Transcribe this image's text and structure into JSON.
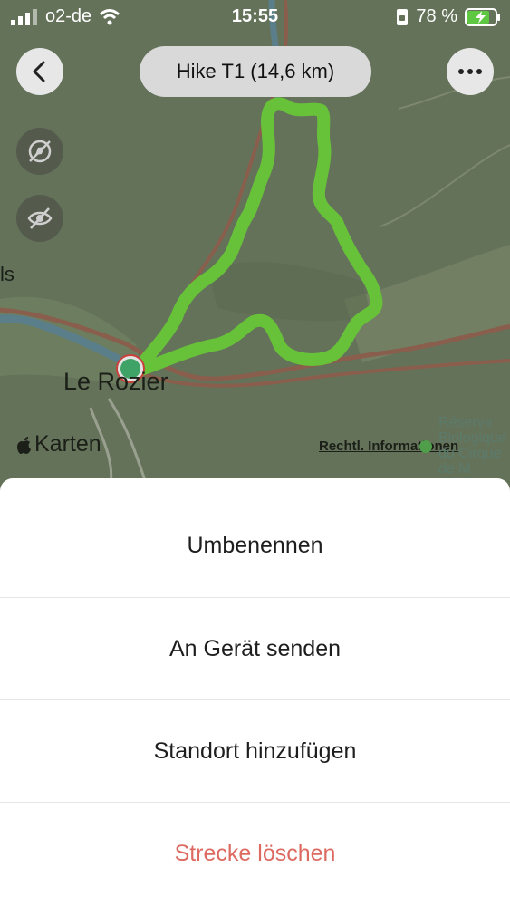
{
  "status_bar": {
    "carrier": "o2-de",
    "time": "15:55",
    "battery_percent": "78 %"
  },
  "header": {
    "title": "Hike T1 (14,6 km)"
  },
  "map": {
    "place_label": "Le Rozier",
    "edge_label": "ls",
    "brand_label": "Karten",
    "legal_link": "Rechtl. Informationen",
    "reserve_label_lines": [
      "Réserve",
      "Biologique",
      "du Cirque",
      "de M"
    ],
    "route_color": "#67c23a"
  },
  "action_sheet": {
    "items": [
      {
        "label": "Umbenennen",
        "style": "default"
      },
      {
        "label": "An Gerät senden",
        "style": "default"
      },
      {
        "label": "Standort hinzufügen",
        "style": "default"
      },
      {
        "label": "Strecke löschen",
        "style": "destructive"
      }
    ]
  },
  "icons": {
    "back": "chevron-left-icon",
    "more": "more-dots-icon",
    "compass_off": "location-slash-icon",
    "eye_off": "eye-slash-icon"
  }
}
